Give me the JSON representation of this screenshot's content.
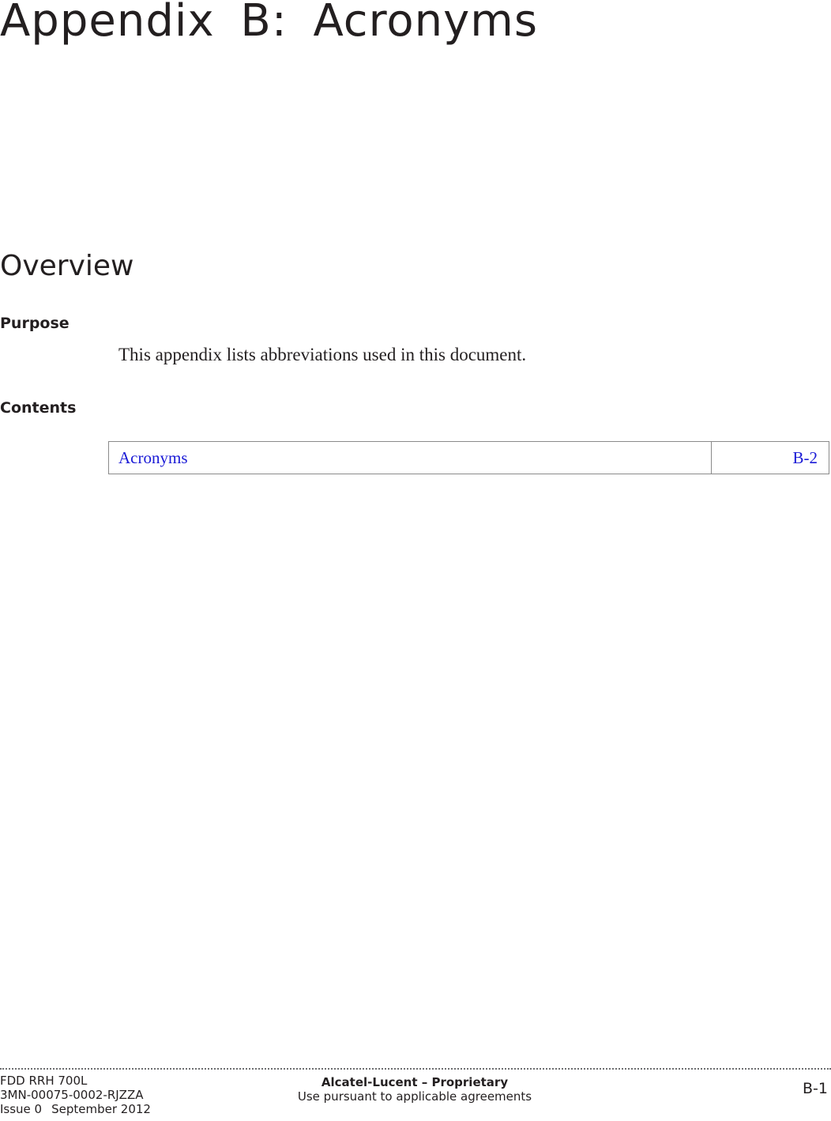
{
  "header": {
    "chapter_title": "Appendix B:  Acronyms"
  },
  "overview": {
    "title": "Overview",
    "purpose_heading": "Purpose",
    "purpose_text": "This appendix lists abbreviations used in this document.",
    "contents_heading": "Contents",
    "contents": [
      {
        "label": "Acronyms",
        "page": "B-2"
      }
    ]
  },
  "footer": {
    "product": "FDD RRH 700L",
    "doc_number": "3MN-00075-0002-RJZZA",
    "issue": "Issue 0",
    "date": "September 2012",
    "company": "Alcatel-Lucent – Proprietary",
    "usage": "Use pursuant to applicable agreements",
    "page_number": "B-1"
  },
  "colors": {
    "text": "#231f20",
    "link": "#1a1ad6",
    "table_border": "#8a8a8a"
  }
}
